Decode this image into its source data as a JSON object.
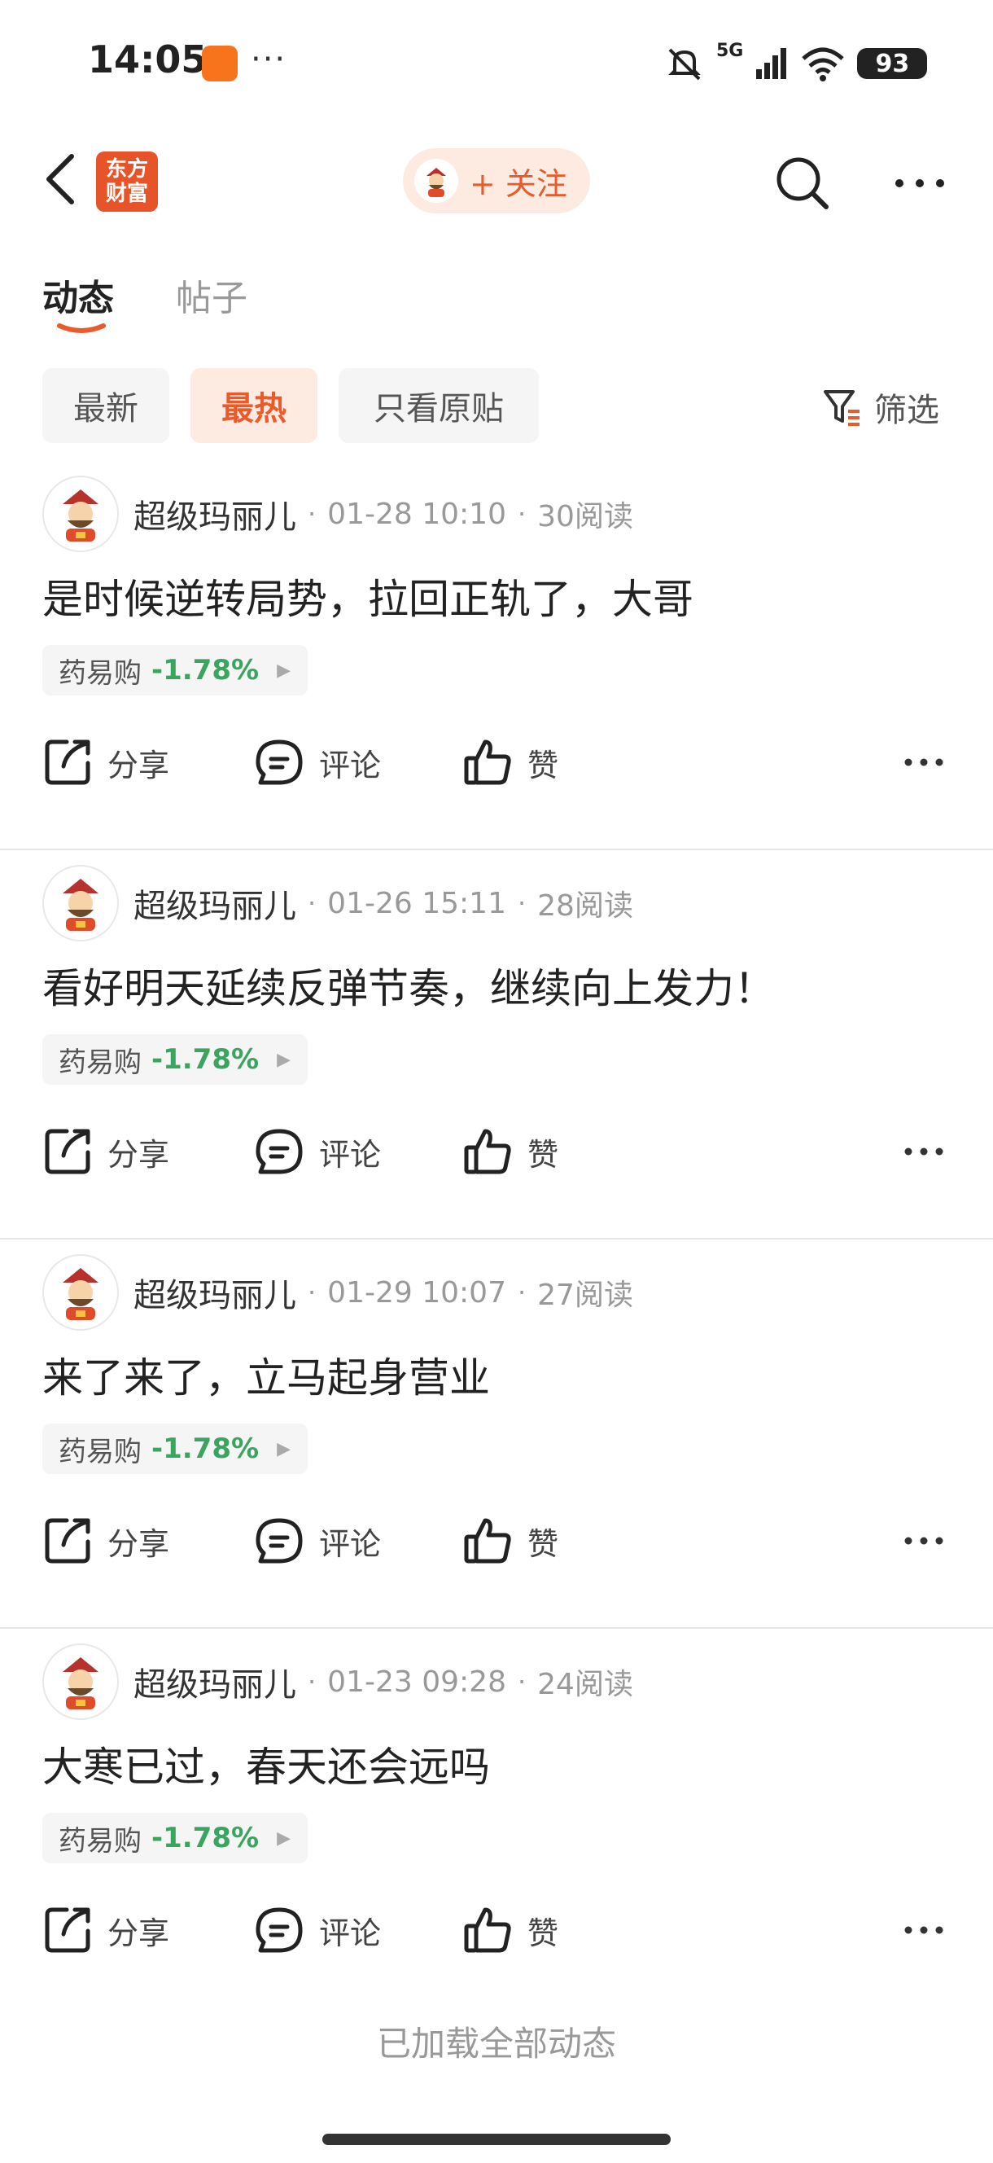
{
  "status_bar": {
    "time": "14:05",
    "dots": "···",
    "network": "5G",
    "battery": "93"
  },
  "header": {
    "logo_line1": "东方",
    "logo_line2": "财富",
    "follow_label": "+ 关注"
  },
  "tabs": [
    {
      "label": "动态",
      "active": true
    },
    {
      "label": "帖子",
      "active": false
    }
  ],
  "filters": {
    "chips": [
      "最新",
      "最热",
      "只看原贴"
    ],
    "active": "最热",
    "filter_label": "筛选"
  },
  "posts": [
    {
      "author": "超级玛丽儿",
      "time": "01-28 10:10",
      "reads": "30阅读",
      "content": "是时候逆转局势，拉回正轨了，大哥",
      "stock": "药易购",
      "change": "-1.78%"
    },
    {
      "author": "超级玛丽儿",
      "time": "01-26 15:11",
      "reads": "28阅读",
      "content": "看好明天延续反弹节奏，继续向上发力！",
      "stock": "药易购",
      "change": "-1.78%"
    },
    {
      "author": "超级玛丽儿",
      "time": "01-29 10:07",
      "reads": "27阅读",
      "content": "来了来了，立马起身营业",
      "stock": "药易购",
      "change": "-1.78%"
    },
    {
      "author": "超级玛丽儿",
      "time": "01-23 09:28",
      "reads": "24阅读",
      "content": "大寒已过，春天还会远吗",
      "stock": "药易购",
      "change": "-1.78%"
    }
  ],
  "actions": {
    "share": "分享",
    "comment": "评论",
    "like": "赞"
  },
  "footer": {
    "loaded_text": "已加载全部动态"
  },
  "colors": {
    "accent": "#ea5b2c",
    "accent_bg": "#fdebe1",
    "stock_change": "#3aa55f",
    "logo_bg": "#e8542a"
  }
}
